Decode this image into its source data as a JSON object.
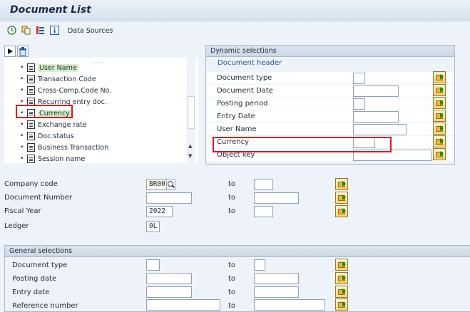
{
  "window": {
    "title": "Document List"
  },
  "toolbar": {
    "data_sources_label": "Data Sources"
  },
  "tree": {
    "items": [
      {
        "label": "User Name"
      },
      {
        "label": "Transaction Code"
      },
      {
        "label": "Cross-Comp.Code No."
      },
      {
        "label": "Recurring entry doc."
      },
      {
        "label": "Currency"
      },
      {
        "label": "Exchange rate"
      },
      {
        "label": "Doc.status"
      },
      {
        "label": "Business Transaction"
      },
      {
        "label": "Session name"
      }
    ]
  },
  "dynamic": {
    "header": "Dynamic selections",
    "subheader": "Document header",
    "rows": [
      {
        "label": "Document type",
        "value": ""
      },
      {
        "label": "Document Date",
        "value": ""
      },
      {
        "label": "Posting period",
        "value": ""
      },
      {
        "label": "Entry Date",
        "value": ""
      },
      {
        "label": "User Name",
        "value": ""
      },
      {
        "label": "Currency",
        "value": ""
      },
      {
        "label": "Object key",
        "value": ""
      }
    ]
  },
  "main": {
    "to_label": "to",
    "company_code": {
      "label": "Company code",
      "from": "BR00",
      "to": ""
    },
    "document_number": {
      "label": "Document Number",
      "from": "",
      "to": ""
    },
    "fiscal_year": {
      "label": "Fiscal Year",
      "from": "2022",
      "to": ""
    },
    "ledger": {
      "label": "Ledger",
      "value": "0L"
    }
  },
  "general": {
    "header": "General selections",
    "rows": [
      {
        "label": "Document type",
        "from": "",
        "to": ""
      },
      {
        "label": "Posting date",
        "from": "",
        "to": ""
      },
      {
        "label": "Entry date",
        "from": "",
        "to": ""
      },
      {
        "label": "Reference number",
        "from": "",
        "to": ""
      }
    ]
  }
}
